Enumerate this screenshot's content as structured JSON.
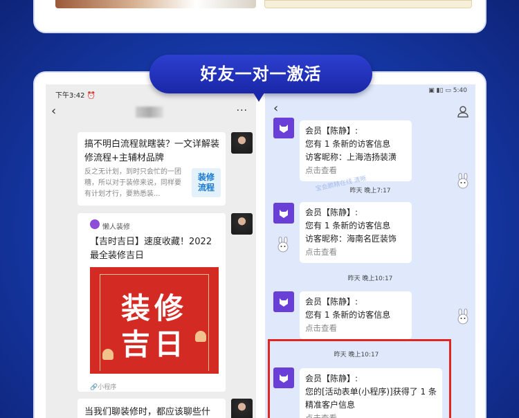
{
  "banner": {
    "title": "好友一对一激活"
  },
  "left_phone": {
    "status_time": "下午3:42 ⏰",
    "back_icon": "chevron-left-icon",
    "more_icon": "more-icon",
    "more_glyph": "···",
    "back_glyph": "‹",
    "msg1": {
      "title": "搞不明白流程就瞎装？一文详解装修流程+主辅材品牌",
      "desc": "反之无计划，到时只会忙的一团糟，所以对于装修来说，同样要有计划才行，要熟悉装...",
      "logo": "装修\n流程"
    },
    "msg2": {
      "source": "懒人装修",
      "title": "【吉时吉日】速度收藏！2022最全装修吉日",
      "poster_text": "装修\n吉日",
      "footer": "🔗小程序"
    },
    "msg3": {
      "title": "当我们聊装修时，都应该聊些什"
    }
  },
  "right_phone": {
    "status_right": "▣ ▮▯ ▭ 5:40",
    "back_glyph": "‹",
    "user_icon": "user-icon",
    "watermark": "宝会鹏精在线  清晰",
    "msg_a": {
      "line1": "会员【陈静】:",
      "line2": "您有 1 条新的访客信息",
      "line3": "访客昵称：上海浩扬装潢",
      "link": "点击查看"
    },
    "ts1": "昨天 晚上7:17",
    "msg_b": {
      "line1": "会员【陈静】:",
      "line2": "您有 1 条新的访客信息",
      "line3": "访客昵称：海南名匠装饰",
      "link": "点击查看"
    },
    "ts2": "昨天 晚上10:17",
    "msg_c": {
      "line1": "会员【陈静】:",
      "line2": "您有 1 条新的访客信息",
      "link": "点击查看"
    },
    "ts3": "昨天 晚上10:17",
    "msg_d": {
      "line1": "会员【陈静】:",
      "line2": "您的[活动表单(小程序)]获得了 1 条精准客户信息",
      "link": "点击查看"
    }
  },
  "colors": {
    "highlight": "#e0271f",
    "accent": "#6a3fd8",
    "banner": "#1a27a8"
  }
}
